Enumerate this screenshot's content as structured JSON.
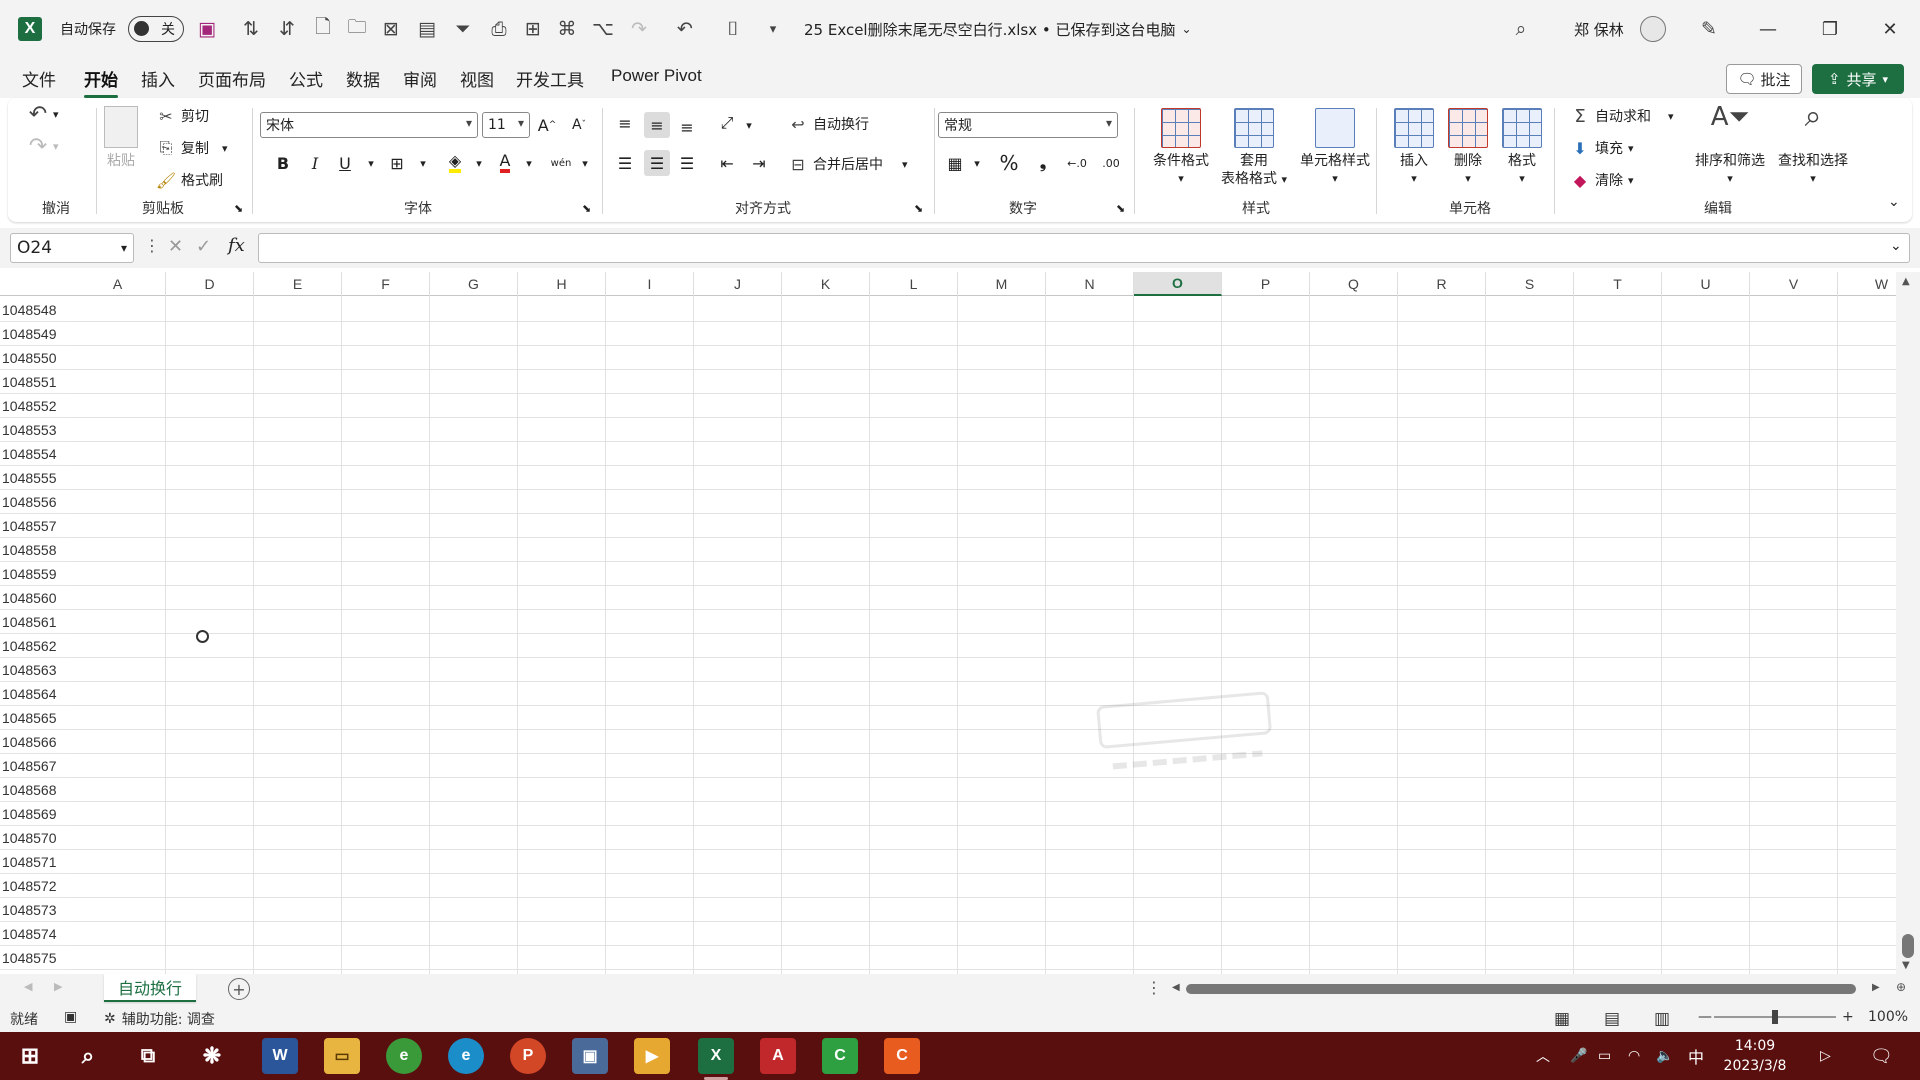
{
  "titlebar": {
    "autosave_label": "自动保存",
    "autosave_state": "关",
    "filename": "25 Excel删除末尾无尽空白行.xlsx • 已保存到这台电脑",
    "user_name": "郑 保林"
  },
  "menu": {
    "tabs": [
      "文件",
      "开始",
      "插入",
      "页面布局",
      "公式",
      "数据",
      "审阅",
      "视图",
      "开发工具",
      "Power Pivot"
    ],
    "active_tab": "开始",
    "comment_label": "批注",
    "share_label": "共享"
  },
  "ribbon": {
    "groups": {
      "undo": "撤消",
      "clipboard": "剪贴板",
      "font": "字体",
      "alignment": "对齐方式",
      "number": "数字",
      "styles": "样式",
      "cells": "单元格",
      "editing": "编辑"
    },
    "clipboard": {
      "paste": "粘贴",
      "cut": "剪切",
      "copy": "复制",
      "format_painter": "格式刷"
    },
    "font": {
      "name": "宋体",
      "size": "11",
      "bold": "B",
      "italic": "I",
      "underline": "U",
      "phonetic": "wén"
    },
    "alignment": {
      "wrap_text": "自动换行",
      "merge_center": "合并后居中"
    },
    "number": {
      "format": "常规",
      "percent": "%",
      "comma": "❟"
    },
    "styles": {
      "conditional": "条件格式",
      "table_format_1": "套用",
      "table_format_2": "表格格式",
      "cell_styles": "单元格样式"
    },
    "cells": {
      "insert": "插入",
      "delete": "删除",
      "format": "格式"
    },
    "editing": {
      "autosum": "自动求和",
      "fill": "填充",
      "clear": "清除",
      "sort_filter": "排序和筛选",
      "find_select": "查找和选择"
    }
  },
  "formula_bar": {
    "name_box": "O24",
    "fx": "fx",
    "value": ""
  },
  "grid": {
    "columns": [
      "A",
      "D",
      "E",
      "F",
      "G",
      "H",
      "I",
      "J",
      "K",
      "L",
      "M",
      "N",
      "O",
      "P",
      "Q",
      "R",
      "S",
      "T",
      "U",
      "V",
      "W"
    ],
    "active_column": "O",
    "rows": [
      "1048548",
      "1048549",
      "1048550",
      "1048551",
      "1048552",
      "1048553",
      "1048554",
      "1048555",
      "1048556",
      "1048557",
      "1048558",
      "1048559",
      "1048560",
      "1048561",
      "1048562",
      "1048563",
      "1048564",
      "1048565",
      "1048566",
      "1048567",
      "1048568",
      "1048569",
      "1048570",
      "1048571",
      "1048572",
      "1048573",
      "1048574",
      "1048575"
    ]
  },
  "sheets": {
    "tabs": [
      "自动换行"
    ],
    "active": "自动换行"
  },
  "statusbar": {
    "ready": "就绪",
    "accessibility": "辅助功能: 调查",
    "zoom": "100%"
  },
  "taskbar": {
    "time": "14:09",
    "date": "2023/3/8",
    "ime": "中"
  },
  "colors": {
    "excel_green": "#1d6f42",
    "taskbar_bg": "#5a0f0f"
  }
}
